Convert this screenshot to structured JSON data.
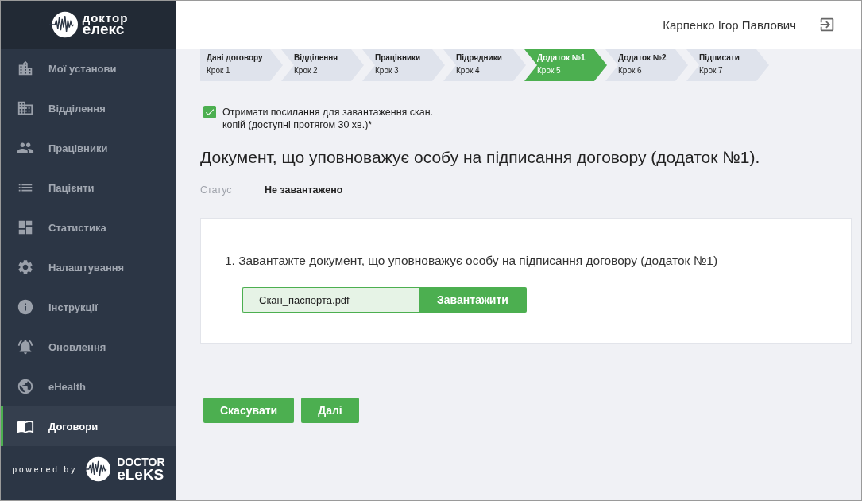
{
  "logo": {
    "line_1": "доктор",
    "line_2": "елекс"
  },
  "sidebar": {
    "items": [
      {
        "label": "Мої установи",
        "selected": false
      },
      {
        "label": "Відділення",
        "selected": false
      },
      {
        "label": "Працівники",
        "selected": false
      },
      {
        "label": "Пацієнти",
        "selected": false
      },
      {
        "label": "Статистика",
        "selected": false
      },
      {
        "label": "Налаштування",
        "selected": false
      },
      {
        "label": "Інструкції",
        "selected": false
      },
      {
        "label": "Оновлення",
        "selected": false
      },
      {
        "label": "eHealth",
        "selected": false
      },
      {
        "label": "Договори",
        "selected": true
      }
    ],
    "footer": {
      "powered_by": "powered by",
      "brand_line_1": "DOCTOR",
      "brand_line_2": "eLeKS"
    }
  },
  "header": {
    "user_name": "Карпенко Ігор Павлович"
  },
  "steps": [
    {
      "title": "Дані договору",
      "subtitle": "Крок 1",
      "selected": false
    },
    {
      "title": "Відділення",
      "subtitle": "Крок 2",
      "selected": false
    },
    {
      "title": "Працівники",
      "subtitle": "Крок 3",
      "selected": false
    },
    {
      "title": "Підрядники",
      "subtitle": "Крок 4",
      "selected": false
    },
    {
      "title": "Додаток №1",
      "subtitle": "Крок 5",
      "selected": true
    },
    {
      "title": "Додаток №2",
      "subtitle": "Крок 6",
      "selected": false
    },
    {
      "title": "Підписати",
      "subtitle": "Крок 7",
      "selected": false
    }
  ],
  "link_checkbox": {
    "label": "Отримати посилання для завантаження скан. копій (доступні протягом 30 хв.)*",
    "checked": true
  },
  "title": "Документ, що уповноважує особу на підписання договору (додаток №1).",
  "status": {
    "label": "Статус",
    "value": "Не завантажено"
  },
  "upload_card": {
    "instruction": "1. Завантажте документ, що уповноважує особу на підписання договору (додаток №1)",
    "file_name": "Скан_паспорта.pdf",
    "upload_button": "Завантажити"
  },
  "buttons": {
    "cancel": "Скасувати",
    "next": "Далі"
  }
}
